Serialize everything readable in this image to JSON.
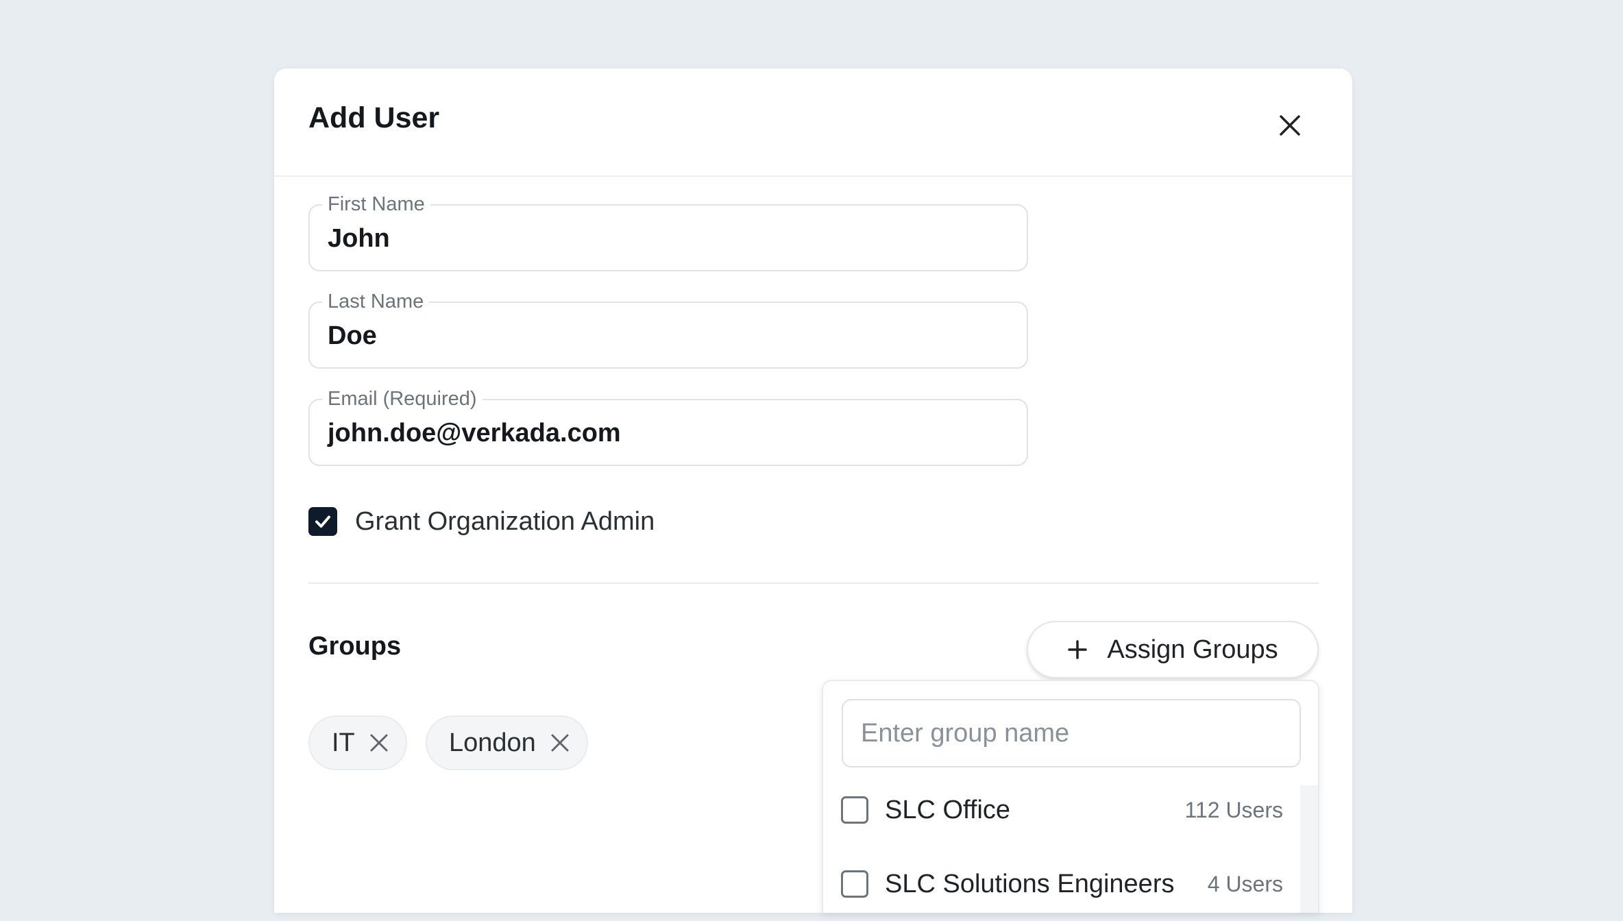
{
  "modal": {
    "title": "Add User"
  },
  "form": {
    "first_name": {
      "label": "First Name",
      "value": "John"
    },
    "last_name": {
      "label": "Last Name",
      "value": "Doe"
    },
    "email": {
      "label": "Email (Required)",
      "value": "john.doe@verkada.com"
    },
    "grant_admin": {
      "label": "Grant Organization Admin",
      "checked": true
    }
  },
  "groups": {
    "title": "Groups",
    "assign_button": {
      "icon": "plus-icon",
      "label": "Assign Groups"
    },
    "chips": [
      {
        "label": "IT"
      },
      {
        "label": "London"
      }
    ],
    "dropdown": {
      "search_placeholder": "Enter group name",
      "options": [
        {
          "name": "SLC Office",
          "count": "112 Users",
          "checked": false
        },
        {
          "name": "SLC Solutions Engineers",
          "count": "4 Users",
          "checked": false
        }
      ]
    }
  },
  "colors": {
    "background": "#e8edf1",
    "checkbox_checked": "#0e1b2a",
    "chip_background": "#f4f5f6"
  }
}
